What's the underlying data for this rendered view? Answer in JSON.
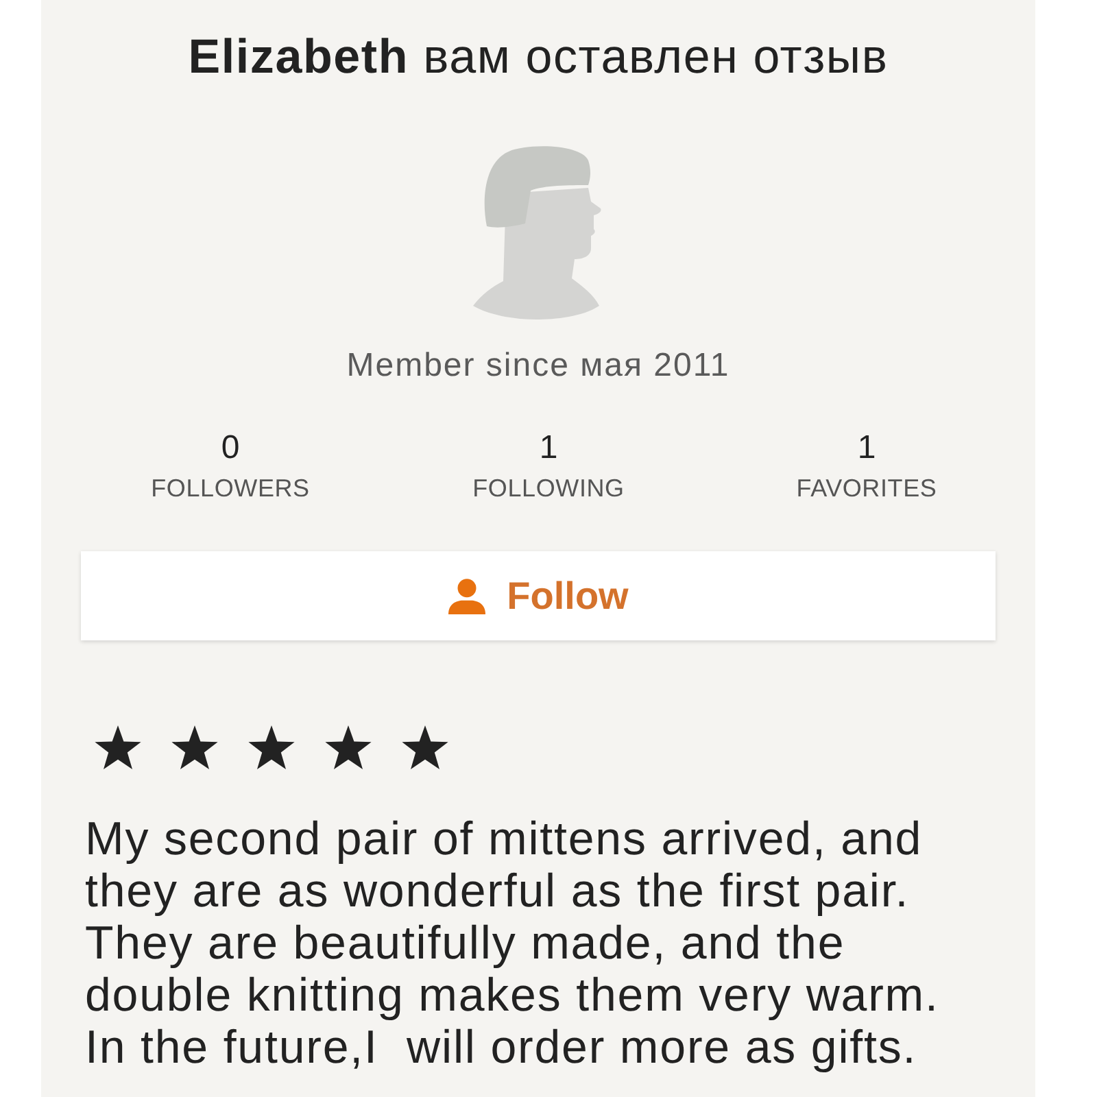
{
  "header": {
    "title": "**Elizabeth** вам оставлен отзыв"
  },
  "profile": {
    "member_since": "Member since мая 2011"
  },
  "stats": [
    {
      "value": "0",
      "label": "FOLLOWERS"
    },
    {
      "value": "1",
      "label": "FOLLOWING"
    },
    {
      "value": "1",
      "label": "FAVORITES"
    }
  ],
  "follow_button": {
    "label": "Follow"
  },
  "review": {
    "stars": 5,
    "text": "My second pair of mittens arrived, and they are as wonderful as the first pair. They are beautifully made, and the double knitting makes them very warm. In the future,I  will order more as gifts."
  }
}
